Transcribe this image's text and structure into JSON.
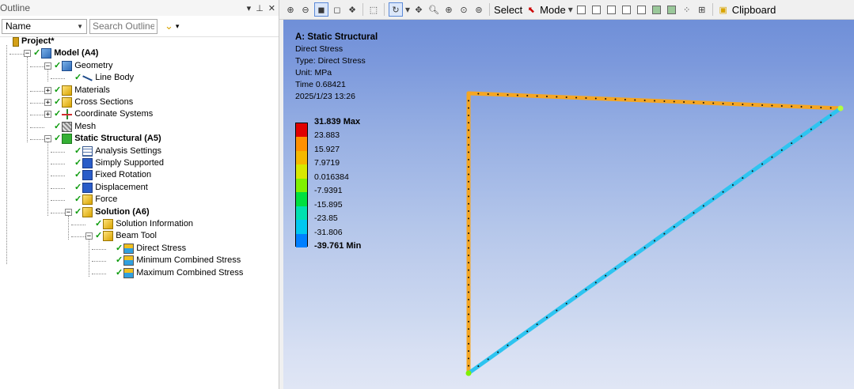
{
  "outline": {
    "title": "Outline",
    "controls": {
      "dropdown": "▾",
      "pin": "⊥",
      "close": "✕"
    },
    "name_select": "Name",
    "search_placeholder": "Search Outline",
    "tree": [
      {
        "label": "Project*",
        "icon": "project-icon",
        "bold": true,
        "check": false,
        "level": 0
      },
      {
        "label": "Model (A4)",
        "icon": "model-icon",
        "bold": true,
        "check": true,
        "level": 1,
        "expander": "-"
      },
      {
        "label": "Geometry",
        "icon": "geometry-icon",
        "bold": false,
        "check": true,
        "level": 2,
        "expander": "-"
      },
      {
        "label": "Line Body",
        "icon": "line-body-icon",
        "bold": false,
        "check": true,
        "level": 3
      },
      {
        "label": "Materials",
        "icon": "materials-icon",
        "bold": false,
        "check": true,
        "level": 2,
        "expander": "+"
      },
      {
        "label": "Cross Sections",
        "icon": "cross-sections-icon",
        "bold": false,
        "check": true,
        "level": 2,
        "expander": "+"
      },
      {
        "label": "Coordinate Systems",
        "icon": "coordinate-systems-icon",
        "bold": false,
        "check": true,
        "level": 2,
        "expander": "+"
      },
      {
        "label": "Mesh",
        "icon": "mesh-icon",
        "bold": false,
        "check": true,
        "level": 2
      },
      {
        "label": "Static Structural (A5)",
        "icon": "static-structural-icon",
        "bold": true,
        "check": true,
        "level": 2,
        "expander": "-"
      },
      {
        "label": "Analysis Settings",
        "icon": "analysis-settings-icon",
        "bold": false,
        "check": true,
        "level": 3
      },
      {
        "label": "Simply Supported",
        "icon": "simply-supported-icon",
        "bold": false,
        "check": true,
        "level": 3
      },
      {
        "label": "Fixed Rotation",
        "icon": "fixed-rotation-icon",
        "bold": false,
        "check": true,
        "level": 3
      },
      {
        "label": "Displacement",
        "icon": "displacement-icon",
        "bold": false,
        "check": true,
        "level": 3
      },
      {
        "label": "Force",
        "icon": "force-icon",
        "bold": false,
        "check": true,
        "level": 3
      },
      {
        "label": "Solution (A6)",
        "icon": "solution-icon",
        "bold": true,
        "check": true,
        "level": 3,
        "expander": "-"
      },
      {
        "label": "Solution Information",
        "icon": "solution-information-icon",
        "bold": false,
        "check": true,
        "level": 4
      },
      {
        "label": "Beam Tool",
        "icon": "beam-tool-icon",
        "bold": false,
        "check": true,
        "level": 4,
        "expander": "-"
      },
      {
        "label": "Direct Stress",
        "icon": "direct-stress-icon",
        "bold": false,
        "check": true,
        "level": 5
      },
      {
        "label": "Minimum Combined Stress",
        "icon": "minimum-combined-stress-icon",
        "bold": false,
        "check": true,
        "level": 5
      },
      {
        "label": "Maximum Combined Stress",
        "icon": "maximum-combined-stress-icon",
        "bold": false,
        "check": true,
        "level": 5
      }
    ]
  },
  "toolbar": {
    "select_label": "Select",
    "mode_label": "Mode",
    "clipboard_label": "Clipboard"
  },
  "viewport": {
    "title": "A: Static Structural",
    "result_name": "Direct Stress",
    "type": "Type: Direct Stress",
    "unit": "Unit: MPa",
    "time": "Time 0.68421",
    "date": "2025/1/23 13:26",
    "legend": [
      {
        "value": "31.839 Max",
        "color": "#e00000"
      },
      {
        "value": "23.883",
        "color": "#ff9000"
      },
      {
        "value": "15.927",
        "color": "#f5b800"
      },
      {
        "value": "7.9719",
        "color": "#d8e800"
      },
      {
        "value": "0.016384",
        "color": "#80f000"
      },
      {
        "value": "-7.9391",
        "color": "#00e040"
      },
      {
        "value": "-15.895",
        "color": "#00e0b0"
      },
      {
        "value": "-23.85",
        "color": "#00c8f0"
      },
      {
        "value": "-31.806",
        "color": "#0080ff"
      },
      {
        "value": "-39.761 Min",
        "color": "#0010ff"
      }
    ],
    "colors": {
      "top_member": "#f5a623",
      "diagonal_member": "#2ec4f0",
      "vertical_member": "#f5a623"
    }
  }
}
